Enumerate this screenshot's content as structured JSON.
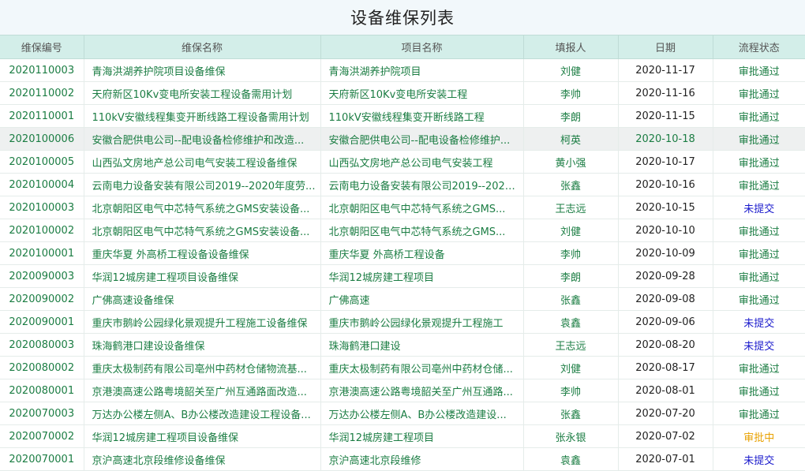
{
  "page": {
    "title": "设备维保列表"
  },
  "columns": [
    "维保编号",
    "维保名称",
    "项目名称",
    "填报人",
    "日期",
    "流程状态"
  ],
  "colors": {
    "approved": "#1b7d43",
    "unsubmitted": "#1a1acc",
    "pending": "#e8a100"
  },
  "rows": [
    {
      "code": "2020110003",
      "name": "青海洪湖养护院项目设备维保",
      "project": "青海洪湖养护院项目",
      "reporter": "刘健",
      "date": "2020-11-17",
      "status": "审批通过",
      "status_type": "approved"
    },
    {
      "code": "2020110002",
      "name": "天府新区10Kv变电所安装工程设备需用计划",
      "project": "天府新区10Kv变电所安装工程",
      "reporter": "李帅",
      "date": "2020-11-16",
      "status": "审批通过",
      "status_type": "approved"
    },
    {
      "code": "2020110001",
      "name": "110kV安徽线程集变开断线路工程设备需用计划",
      "project": "110kV安徽线程集变开断线路工程",
      "reporter": "李朗",
      "date": "2020-11-15",
      "status": "审批通过",
      "status_type": "approved"
    },
    {
      "code": "2020100006",
      "name": "安徽合肥供电公司--配电设备检修维护和改造...",
      "project": "安徽合肥供电公司--配电设备检修维护...",
      "reporter": "柯英",
      "date": "2020-10-18",
      "status": "审批通过",
      "status_type": "approved",
      "highlight": true
    },
    {
      "code": "2020100005",
      "name": "山西弘文房地产总公司电气安装工程设备维保",
      "project": "山西弘文房地产总公司电气安装工程",
      "reporter": "黄小强",
      "date": "2020-10-17",
      "status": "审批通过",
      "status_type": "approved"
    },
    {
      "code": "2020100004",
      "name": "云南电力设备安装有限公司2019--2020年度劳...",
      "project": "云南电力设备安装有限公司2019--2020...",
      "reporter": "张鑫",
      "date": "2020-10-16",
      "status": "审批通过",
      "status_type": "approved"
    },
    {
      "code": "2020100003",
      "name": "北京朝阳区电气中芯特气系统之GMS安装设备...",
      "project": "北京朝阳区电气中芯特气系统之GMS...",
      "reporter": "王志远",
      "date": "2020-10-15",
      "status": "未提交",
      "status_type": "unsubmitted"
    },
    {
      "code": "2020100002",
      "name": "北京朝阳区电气中芯特气系统之GMS安装设备...",
      "project": "北京朝阳区电气中芯特气系统之GMS...",
      "reporter": "刘健",
      "date": "2020-10-10",
      "status": "审批通过",
      "status_type": "approved"
    },
    {
      "code": "2020100001",
      "name": "重庆华夏 外高桥工程设备设备维保",
      "project": "重庆华夏 外高桥工程设备",
      "reporter": "李帅",
      "date": "2020-10-09",
      "status": "审批通过",
      "status_type": "approved"
    },
    {
      "code": "2020090003",
      "name": "华润12城房建工程项目设备维保",
      "project": "华润12城房建工程项目",
      "reporter": "李朗",
      "date": "2020-09-28",
      "status": "审批通过",
      "status_type": "approved"
    },
    {
      "code": "2020090002",
      "name": "广佛高速设备维保",
      "project": "广佛高速",
      "reporter": "张鑫",
      "date": "2020-09-08",
      "status": "审批通过",
      "status_type": "approved"
    },
    {
      "code": "2020090001",
      "name": "重庆市鹅岭公园绿化景观提升工程施工设备维保",
      "project": "重庆市鹅岭公园绿化景观提升工程施工",
      "reporter": "袁鑫",
      "date": "2020-09-06",
      "status": "未提交",
      "status_type": "unsubmitted"
    },
    {
      "code": "2020080003",
      "name": "珠海鹤港口建设设备维保",
      "project": "珠海鹤港口建设",
      "reporter": "王志远",
      "date": "2020-08-20",
      "status": "未提交",
      "status_type": "unsubmitted"
    },
    {
      "code": "2020080002",
      "name": "重庆太极制药有限公司亳州中药材仓储物流基...",
      "project": "重庆太极制药有限公司亳州中药材仓储...",
      "reporter": "刘健",
      "date": "2020-08-17",
      "status": "审批通过",
      "status_type": "approved"
    },
    {
      "code": "2020080001",
      "name": "京港澳高速公路粤境韶关至广州互通路面改造...",
      "project": "京港澳高速公路粤境韶关至广州互通路...",
      "reporter": "李帅",
      "date": "2020-08-01",
      "status": "审批通过",
      "status_type": "approved"
    },
    {
      "code": "2020070003",
      "name": "万达办公楼左侧A、B办公楼改造建设工程设备...",
      "project": "万达办公楼左侧A、B办公楼改造建设...",
      "reporter": "张鑫",
      "date": "2020-07-20",
      "status": "审批通过",
      "status_type": "approved"
    },
    {
      "code": "2020070002",
      "name": "华润12城房建工程项目设备维保",
      "project": "华润12城房建工程项目",
      "reporter": "张永银",
      "date": "2020-07-02",
      "status": "审批中",
      "status_type": "pending"
    },
    {
      "code": "2020070001",
      "name": "京沪高速北京段维修设备维保",
      "project": "京沪高速北京段维修",
      "reporter": "袁鑫",
      "date": "2020-07-01",
      "status": "未提交",
      "status_type": "unsubmitted"
    }
  ]
}
